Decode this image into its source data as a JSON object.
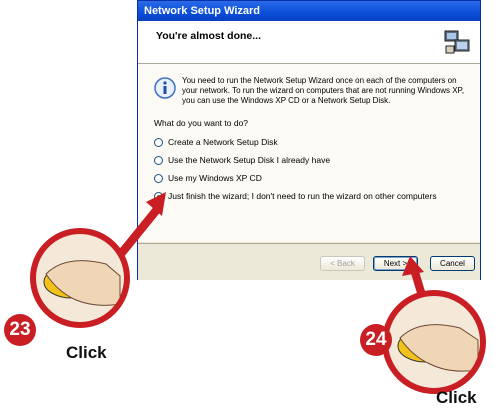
{
  "window": {
    "title": "Network Setup Wizard",
    "header_title": "You're almost done...",
    "info_text": "You need to run the Network Setup Wizard once on each of the computers on your network. To run the wizard on computers that are not running Windows XP, you can use the Windows XP CD or a Network Setup Disk.",
    "question": "What do you want to do?",
    "options": [
      {
        "label": "Create a Network Setup Disk",
        "selected": false
      },
      {
        "label": "Use the Network Setup Disk I already have",
        "selected": false
      },
      {
        "label": "Use my Windows XP CD",
        "selected": false
      },
      {
        "label": "Just finish the wizard; I don't need to run the wizard on other computers",
        "selected": true
      }
    ],
    "buttons": {
      "back": "< Back",
      "next": "Next >",
      "cancel": "Cancel"
    }
  },
  "annotations": {
    "step1": {
      "number": "23",
      "label": "Click"
    },
    "step2": {
      "number": "24",
      "label": "Click"
    },
    "accent_color": "#c81e24"
  }
}
